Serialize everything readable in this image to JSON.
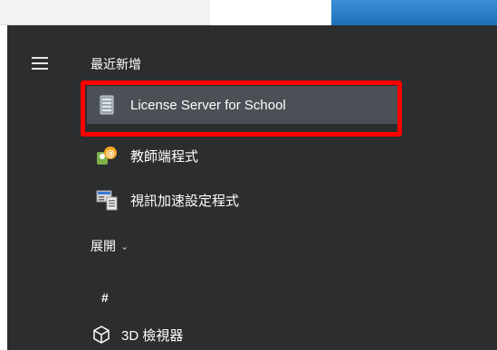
{
  "menu": {
    "section_title": "最近新增",
    "apps": [
      {
        "label": "License Server for School",
        "icon": "server-icon"
      },
      {
        "label": "教師端程式",
        "icon": "teacher-app-icon"
      },
      {
        "label": "視訊加速設定程式",
        "icon": "video-settings-icon"
      }
    ],
    "expand_label": "展開",
    "group_letter": "#",
    "bottom_app": {
      "label": "3D 檢視器",
      "icon": "3d-cube-icon"
    }
  },
  "colors": {
    "menu_bg": "#2b2d2f",
    "selected_bg": "#4a5055",
    "highlight": "#ff0000"
  }
}
